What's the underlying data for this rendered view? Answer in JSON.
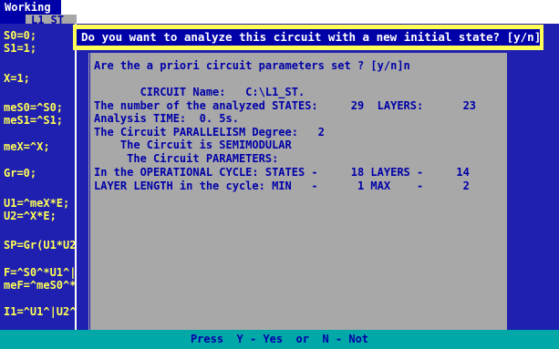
{
  "window": {
    "title": "Working"
  },
  "tab": {
    "label": "L1_ST"
  },
  "code_lines": [
    "S0=0;",
    "S1=1;",
    "X=1;",
    "meS0=^S0;",
    "meS1=^S1;",
    "meX=^X;",
    "Gr=0;",
    "U1=^meX*E;",
    "U2=^X*E;",
    "SP=Gr(U1*U2",
    "F=^S0^*U1^|",
    "meF=^meS0^*",
    "I1=^U1^|U2^"
  ],
  "dialog": {
    "prompt": "Do you want to analyze this circuit with a new initial state? [y/n]"
  },
  "info_lines": [
    "Are the a priori circuit parameters set ? [y/n]n",
    "",
    "       CIRCUIT Name:   C:\\L1_ST.",
    "The number of the analyzed STATES:     29  LAYERS:      23",
    "Analysis TIME:  0. 5s.",
    "The Circuit PARALLELISM Degree:   2",
    "    The Circuit is SEMIMODULAR",
    "     The Circuit PARAMETERS:",
    "In the OPERATIONAL CYCLE: STATES -     18 LAYERS -     14",
    "LAYER LENGTH in the cycle: MIN   -      1 MAX    -      2"
  ],
  "status_bar": {
    "text": "Press  Y - Yes  or  N - Not"
  },
  "colors": {
    "background": "#1f1fb0",
    "code_text": "#ffff55",
    "dialog_border": "#ffff55",
    "dialog_bg": "#0000a8",
    "panel_bg": "#a8a8a8",
    "status_bg": "#00a8a8"
  }
}
